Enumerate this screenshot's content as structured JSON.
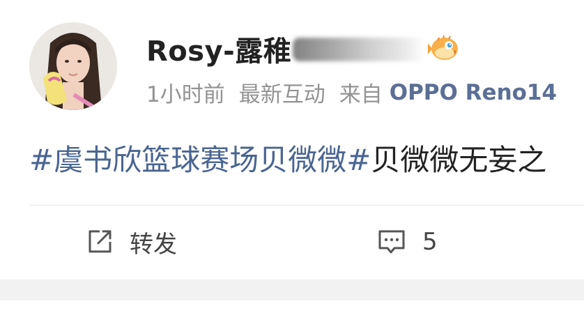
{
  "post": {
    "author": {
      "name_visible": "Rosy-露稚",
      "badge_icon": "pufferfish-badge-icon"
    },
    "meta": {
      "time": "1小时前",
      "status": "最新互动",
      "source_prefix": "来自",
      "device": "OPPO Reno14"
    },
    "content": {
      "topic": "#虞书欣篮球赛场贝微微#",
      "text": "贝微微无妄之"
    },
    "actions": {
      "repost_label": "转发",
      "comment_count": "5"
    }
  },
  "colors": {
    "topic_link": "#4a6591",
    "device_link": "#5b6f95",
    "meta_gray": "#939393",
    "separator_band": "#f2f2f2"
  }
}
